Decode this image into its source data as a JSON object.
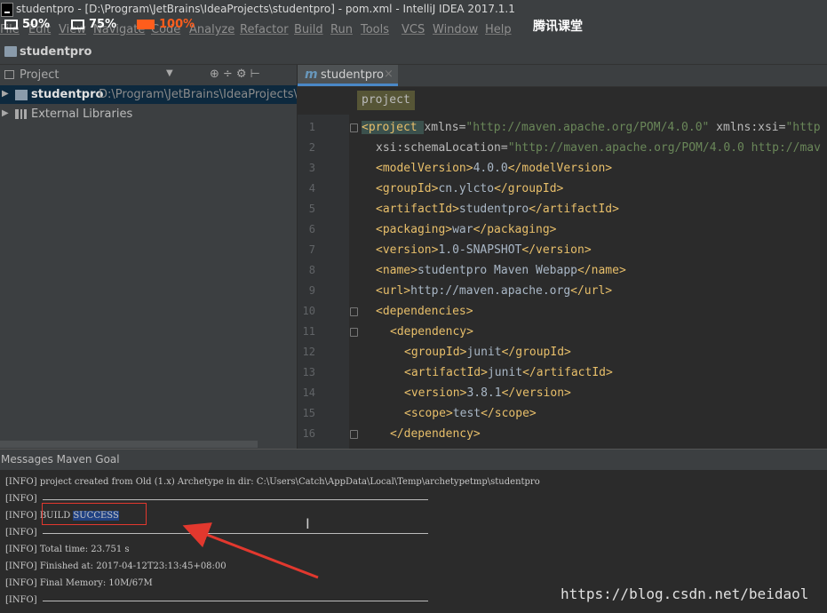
{
  "window": {
    "title": "studentpro - [D:\\Program\\JetBrains\\IdeaProjects\\studentpro] - pom.xml - IntelliJ IDEA 2017.1.1"
  },
  "menu": [
    "File",
    "Edit",
    "View",
    "Navigate",
    "Code",
    "Analyze",
    "Refactor",
    "Build",
    "Run",
    "Tools",
    "VCS",
    "Window",
    "Help"
  ],
  "overlay": {
    "zoom_50": "50%",
    "zoom_75": "75%",
    "zoom_100": "100%",
    "brand": "腾讯课堂"
  },
  "navbar": {
    "project": "studentpro"
  },
  "project_panel": {
    "header": "Project",
    "tree": [
      {
        "label": "studentpro",
        "path": "D:\\Program\\JetBrains\\IdeaProjects\\stu"
      },
      {
        "label": "External Libraries"
      }
    ]
  },
  "editor": {
    "tab": "studentpro",
    "breadcrumb": "project",
    "lines": [
      {
        "n": "1",
        "indent": 0,
        "parts": [
          [
            "tag",
            "<project "
          ],
          [
            "attr",
            "xmlns="
          ],
          [
            "val",
            "\"http://maven.apache.org/POM/4.0.0\""
          ],
          [
            "attr",
            " xmlns:xsi="
          ],
          [
            "val",
            "\"http"
          ]
        ]
      },
      {
        "n": "2",
        "indent": 1,
        "parts": [
          [
            "attr",
            "xsi:schemaLocation="
          ],
          [
            "val",
            "\"http://maven.apache.org/POM/4.0.0 http://mav"
          ]
        ]
      },
      {
        "n": "3",
        "indent": 1,
        "parts": [
          [
            "tag",
            "<modelVersion>"
          ],
          [
            "txt",
            "4.0.0"
          ],
          [
            "tag",
            "</modelVersion>"
          ]
        ]
      },
      {
        "n": "4",
        "indent": 1,
        "parts": [
          [
            "tag",
            "<groupId>"
          ],
          [
            "txt",
            "cn.ylcto"
          ],
          [
            "tag",
            "</groupId>"
          ]
        ]
      },
      {
        "n": "5",
        "indent": 1,
        "parts": [
          [
            "tag",
            "<artifactId>"
          ],
          [
            "txt",
            "studentpro"
          ],
          [
            "tag",
            "</artifactId>"
          ]
        ]
      },
      {
        "n": "6",
        "indent": 1,
        "parts": [
          [
            "tag",
            "<packaging>"
          ],
          [
            "txt",
            "war"
          ],
          [
            "tag",
            "</packaging>"
          ]
        ]
      },
      {
        "n": "7",
        "indent": 1,
        "parts": [
          [
            "tag",
            "<version>"
          ],
          [
            "txt",
            "1.0-SNAPSHOT"
          ],
          [
            "tag",
            "</version>"
          ]
        ]
      },
      {
        "n": "8",
        "indent": 1,
        "parts": [
          [
            "tag",
            "<name>"
          ],
          [
            "txt",
            "studentpro Maven Webapp"
          ],
          [
            "tag",
            "</name>"
          ]
        ]
      },
      {
        "n": "9",
        "indent": 1,
        "parts": [
          [
            "tag",
            "<url>"
          ],
          [
            "txt",
            "http://maven.apache.org"
          ],
          [
            "tag",
            "</url>"
          ]
        ]
      },
      {
        "n": "10",
        "indent": 1,
        "parts": [
          [
            "tag",
            "<dependencies>"
          ]
        ]
      },
      {
        "n": "11",
        "indent": 2,
        "parts": [
          [
            "tag",
            "<dependency>"
          ]
        ]
      },
      {
        "n": "12",
        "indent": 3,
        "parts": [
          [
            "tag",
            "<groupId>"
          ],
          [
            "txt",
            "junit"
          ],
          [
            "tag",
            "</groupId>"
          ]
        ]
      },
      {
        "n": "13",
        "indent": 3,
        "parts": [
          [
            "tag",
            "<artifactId>"
          ],
          [
            "txt",
            "junit"
          ],
          [
            "tag",
            "</artifactId>"
          ]
        ]
      },
      {
        "n": "14",
        "indent": 3,
        "parts": [
          [
            "tag",
            "<version>"
          ],
          [
            "txt",
            "3.8.1"
          ],
          [
            "tag",
            "</version>"
          ]
        ]
      },
      {
        "n": "15",
        "indent": 3,
        "parts": [
          [
            "tag",
            "<scope>"
          ],
          [
            "txt",
            "test"
          ],
          [
            "tag",
            "</scope>"
          ]
        ]
      },
      {
        "n": "16",
        "indent": 2,
        "parts": [
          [
            "tag",
            "</dependency>"
          ]
        ]
      }
    ]
  },
  "messages": {
    "title": "Messages Maven Goal",
    "log": [
      {
        "prefix": "[INFO]",
        "text": "project created from Old (1.x) Archetype in dir: C:\\Users\\Catch\\AppData\\Local\\Temp\\archetypetmp\\studentpro"
      },
      {
        "prefix": "[INFO]",
        "text": "",
        "rule": true
      },
      {
        "prefix": "[INFO]",
        "text": "BUILD SUCCESS"
      },
      {
        "prefix": "[INFO]",
        "text": "",
        "rule": true
      },
      {
        "prefix": "[INFO]",
        "text": "Total time: 23.751 s"
      },
      {
        "prefix": "[INFO]",
        "text": "Finished at: 2017-04-12T23:13:45+08:00"
      },
      {
        "prefix": "[INFO]",
        "text": "Final Memory: 10M/67M"
      },
      {
        "prefix": "[INFO]",
        "text": "",
        "rule": true
      }
    ]
  },
  "watermark": "https://blog.csdn.net/beidaol"
}
